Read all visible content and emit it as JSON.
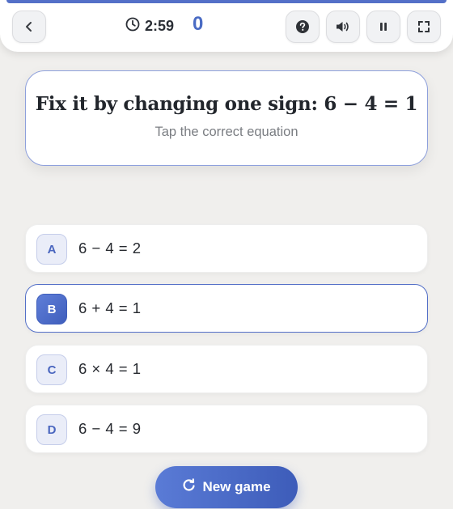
{
  "header": {
    "timer": "2:59",
    "score": "0",
    "back_icon": "chevron-left-icon",
    "help_icon": "question-circle-icon",
    "sound_icon": "speaker-icon",
    "pause_icon": "pause-icon",
    "fullscreen_icon": "fullscreen-icon",
    "accent_color": "#5470c8"
  },
  "prompt": {
    "title": "Fix it by changing one sign: 6 − 4 = 1",
    "subtitle": "Tap the correct equation"
  },
  "options": [
    {
      "letter": "A",
      "equation": "6 − 4 = 2",
      "selected": false
    },
    {
      "letter": "B",
      "equation": "6 + 4 = 1",
      "selected": true
    },
    {
      "letter": "C",
      "equation": "6 × 4 = 1",
      "selected": false
    },
    {
      "letter": "D",
      "equation": "6 − 4 = 9",
      "selected": false
    }
  ],
  "actions": {
    "new_game_label": "New game",
    "new_game_icon": "restart-icon"
  }
}
